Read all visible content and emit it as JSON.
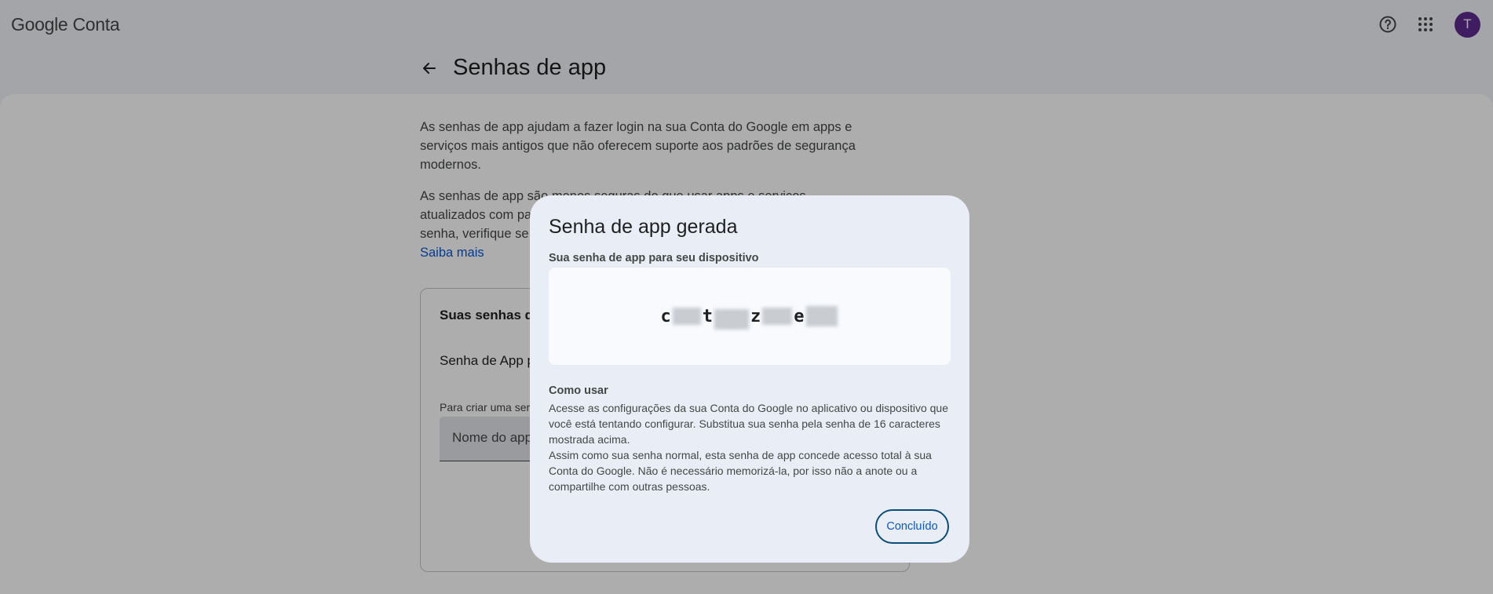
{
  "header": {
    "logo_google": "Google",
    "logo_product": "Conta",
    "help_icon": "help-icon",
    "apps_icon": "apps-grid-icon",
    "avatar_letter": "T"
  },
  "page": {
    "title": "Senhas de app",
    "intro_p1": "As senhas de app ajudam a fazer login na sua Conta do Google em apps e serviços mais antigos que não oferecem suporte aos padrões de segurança modernos.",
    "intro_p2_visible": "As senhas de app são menos seguras do que usar apps e serviços atualizados com pa",
    "intro_p2_line3": "senha, verifique se",
    "learn_more": "Saiba mais"
  },
  "card": {
    "title": "Suas senhas de",
    "row_label": "Senha de App p",
    "hint": "Para criar uma ser",
    "input_placeholder": "Nome do app"
  },
  "dialog": {
    "title": "Senha de app gerada",
    "subtitle": "Sua senha de app para seu dispositivo",
    "password_chars": [
      "c",
      "t",
      "z",
      "e"
    ],
    "how_title": "Como usar",
    "how_p1": "Acesse as configurações da sua Conta do Google no aplicativo ou dispositivo que você está tentando configurar. Substitua sua senha pela senha de 16 caracteres mostrada acima.",
    "how_p2": "Assim como sua senha normal, esta senha de app concede acesso total à sua Conta do Google. Não é necessário memorizá-la, por isso não a anote ou a compartilhe com outras pessoas.",
    "done_label": "Concluído"
  },
  "colors": {
    "accent": "#0b57d0",
    "avatar": "#5f2b8e",
    "dialog_bg": "#e9eef6"
  }
}
